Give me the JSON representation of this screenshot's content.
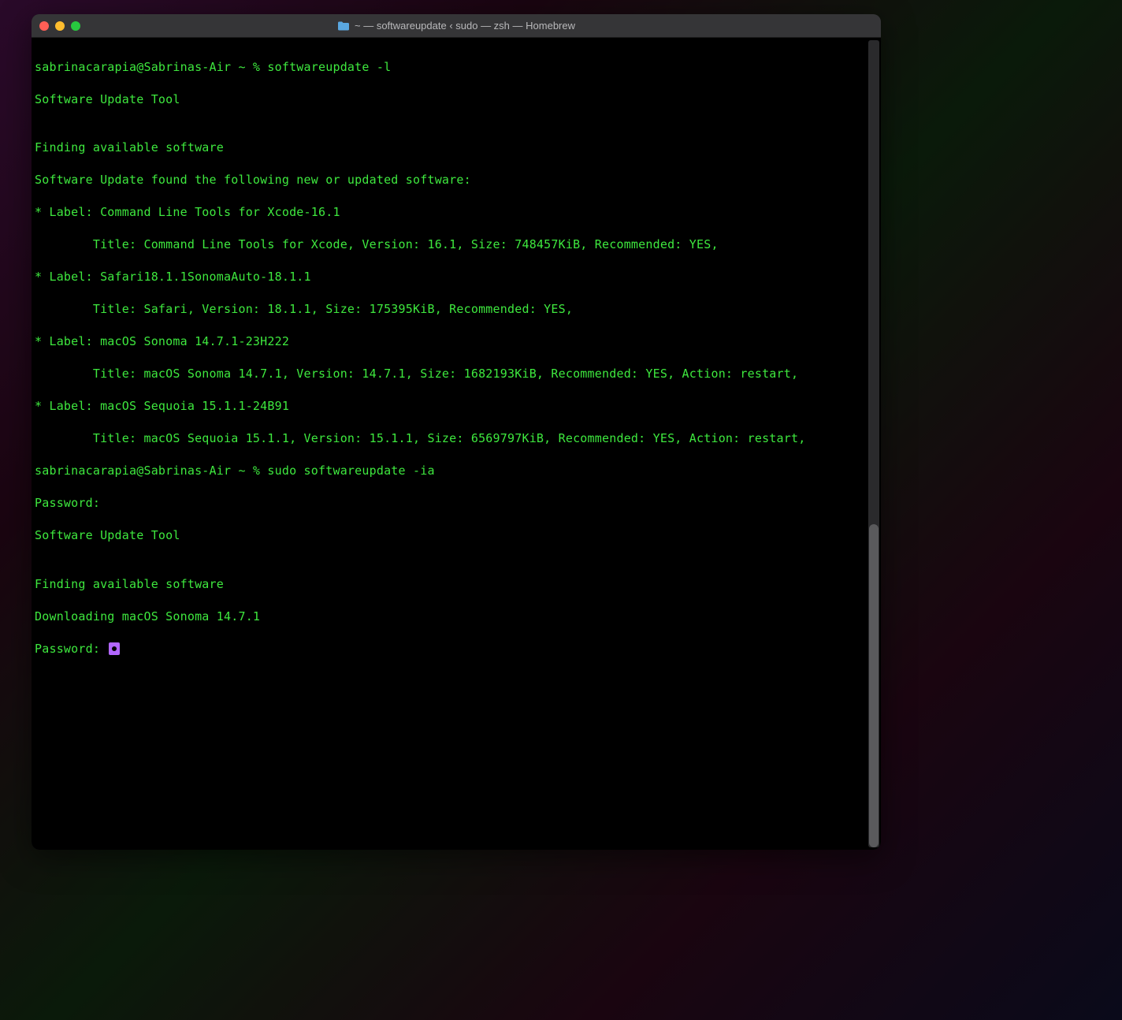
{
  "window": {
    "title": "~ — softwareupdate ‹ sudo — zsh — Homebrew"
  },
  "terminal": {
    "lines": [
      "sabrinacarapia@Sabrinas-Air ~ % softwareupdate -l",
      "Software Update Tool",
      "",
      "Finding available software",
      "Software Update found the following new or updated software:",
      "* Label: Command Line Tools for Xcode-16.1",
      "        Title: Command Line Tools for Xcode, Version: 16.1, Size: 748457KiB, Recommended: YES,",
      "* Label: Safari18.1.1SonomaAuto-18.1.1",
      "        Title: Safari, Version: 18.1.1, Size: 175395KiB, Recommended: YES,",
      "* Label: macOS Sonoma 14.7.1-23H222",
      "        Title: macOS Sonoma 14.7.1, Version: 14.7.1, Size: 1682193KiB, Recommended: YES, Action: restart,",
      "* Label: macOS Sequoia 15.1.1-24B91",
      "        Title: macOS Sequoia 15.1.1, Version: 15.1.1, Size: 6569797KiB, Recommended: YES, Action: restart,",
      "sabrinacarapia@Sabrinas-Air ~ % sudo softwareupdate -ia",
      "Password:",
      "Software Update Tool",
      "",
      "Finding available software",
      "Downloading macOS Sonoma 14.7.1"
    ],
    "password_prompt": "Password: "
  }
}
